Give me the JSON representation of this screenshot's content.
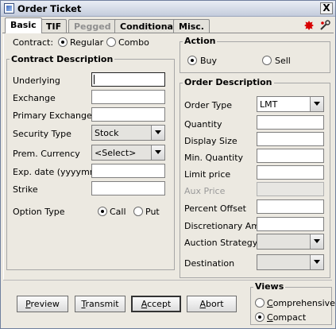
{
  "window": {
    "title": "Order Ticket",
    "close_glyph": "X"
  },
  "tabs": [
    {
      "label": "Basic",
      "active": true
    },
    {
      "label": "TIF"
    },
    {
      "label": "Pegged",
      "disabled": true
    },
    {
      "label": "Conditional"
    },
    {
      "label": "Misc."
    }
  ],
  "header_icons": [
    "bug-icon",
    "tool-icon"
  ],
  "contract": {
    "label": "Contract:",
    "options": [
      {
        "label": "Regular",
        "selected": true
      },
      {
        "label": "Combo",
        "selected": false
      }
    ]
  },
  "contract_description": {
    "title": "Contract Description",
    "underlying": {
      "label": "Underlying",
      "value": ""
    },
    "exchange": {
      "label": "Exchange",
      "value": ""
    },
    "primary_exchange": {
      "label": "Primary Exchange",
      "value": ""
    },
    "security_type": {
      "label": "Security Type",
      "value": "Stock"
    },
    "prem_currency": {
      "label": "Prem. Currency",
      "value": "<Select>"
    },
    "exp_date": {
      "label": "Exp. date (yyyymm)",
      "value": ""
    },
    "strike": {
      "label": "Strike",
      "value": ""
    },
    "option_type": {
      "label": "Option Type",
      "options": [
        {
          "label": "Call",
          "selected": true
        },
        {
          "label": "Put",
          "selected": false
        }
      ]
    }
  },
  "action": {
    "title": "Action",
    "options": [
      {
        "label": "Buy",
        "selected": true
      },
      {
        "label": "Sell",
        "selected": false
      }
    ]
  },
  "order_description": {
    "title": "Order Description",
    "order_type": {
      "label": "Order Type",
      "value": "LMT"
    },
    "quantity": {
      "label": "Quantity",
      "value": ""
    },
    "display_size": {
      "label": "Display Size",
      "value": ""
    },
    "min_quantity": {
      "label": "Min. Quantity",
      "value": ""
    },
    "limit_price": {
      "label": "Limit price",
      "value": ""
    },
    "aux_price": {
      "label": "Aux Price",
      "value": "",
      "disabled": true
    },
    "percent_offset": {
      "label": "Percent Offset",
      "value": ""
    },
    "discretionary_amt": {
      "label": "Discretionary Amt",
      "value": ""
    },
    "auction_strategy": {
      "label": "Auction Strategy",
      "value": ""
    },
    "destination": {
      "label": "Destination",
      "value": ""
    }
  },
  "buttons": {
    "preview": {
      "label": "Preview",
      "mnemonic": "P",
      "rest": "review"
    },
    "transmit": {
      "label": "Transmit",
      "mnemonic": "T",
      "rest": "ransmit"
    },
    "accept": {
      "label": "Accept",
      "mnemonic": "A",
      "rest": "ccept"
    },
    "abort": {
      "label": "Abort",
      "mnemonic": "A",
      "rest": "bort"
    }
  },
  "views": {
    "title": "Views",
    "options": [
      {
        "label": "Comprehensive",
        "mnemonic": "C",
        "rest": "omprehensive",
        "selected": false
      },
      {
        "label": "Compact",
        "mnemonic": "C",
        "rest": "ompact",
        "selected": true
      }
    ]
  },
  "colors": {
    "window_bg": "#ece9e1",
    "bug_red": "#d80000"
  }
}
